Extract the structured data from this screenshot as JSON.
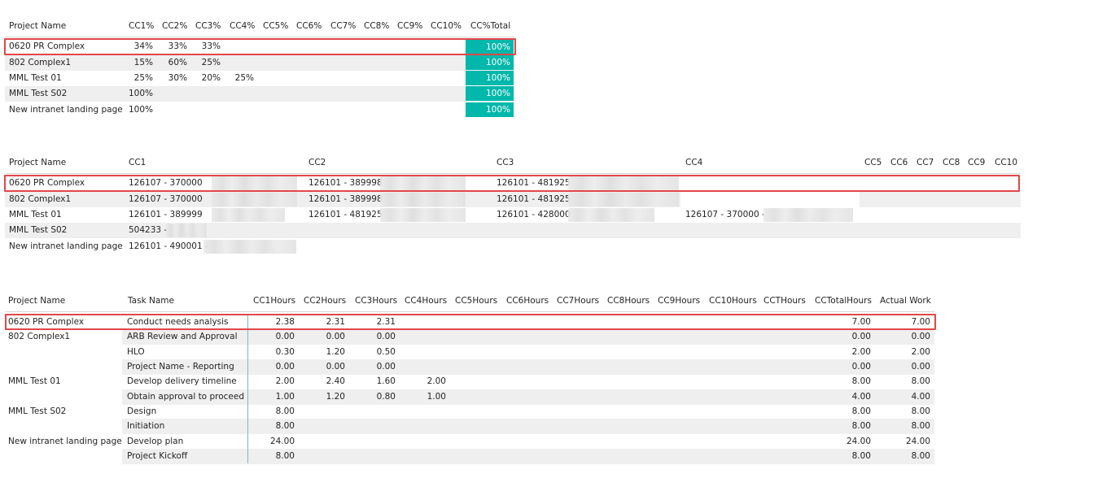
{
  "pct_table": {
    "headers": [
      "Project Name",
      "CC1%",
      "CC2%",
      "CC3%",
      "CC4%",
      "CC5%",
      "CC6%",
      "CC7%",
      "CC8%",
      "CC9%",
      "CC10%",
      "CC%Total"
    ],
    "rows": [
      {
        "name": "0620 PR Complex",
        "cc1": "34%",
        "cc2": "33%",
        "cc3": "33%",
        "cc4": "",
        "total": "100%"
      },
      {
        "name": "802 Complex1",
        "cc1": "15%",
        "cc2": "60%",
        "cc3": "25%",
        "cc4": "",
        "total": "100%"
      },
      {
        "name": "MML Test 01",
        "cc1": "25%",
        "cc2": "30%",
        "cc3": "20%",
        "cc4": "25%",
        "total": "100%"
      },
      {
        "name": "MML Test S02",
        "cc1": "100%",
        "cc2": "",
        "cc3": "",
        "cc4": "",
        "total": "100%"
      },
      {
        "name": "New intranet landing page",
        "cc1": "100%",
        "cc2": "",
        "cc3": "",
        "cc4": "",
        "total": "100%"
      }
    ],
    "total_fill_color": "#01b8aa"
  },
  "code_table": {
    "headers": [
      "Project Name",
      "CC1",
      "CC2",
      "CC3",
      "CC4",
      "CC5",
      "CC6",
      "CC7",
      "CC8",
      "CC9",
      "CC10"
    ],
    "rows": [
      {
        "name": "0620 PR Complex",
        "cc1": "126107 - 370000",
        "cc2": "126101 - 389998",
        "cc3": "126101 - 481925",
        "cc4": ""
      },
      {
        "name": "802 Complex1",
        "cc1": "126107 - 370000",
        "cc2": "126101 - 389998",
        "cc3": "126101 - 481925",
        "cc4": ""
      },
      {
        "name": "MML Test 01",
        "cc1": "126101 - 389999",
        "cc2": "126101 - 481925",
        "cc3": "126101 - 428000",
        "cc4": "126107 - 370000 -"
      },
      {
        "name": "MML Test S02",
        "cc1": "504233 -",
        "cc2": "",
        "cc3": "",
        "cc4": ""
      },
      {
        "name": "New intranet landing page",
        "cc1": "126101 - 490001 -",
        "cc2": "",
        "cc3": "",
        "cc4": ""
      }
    ]
  },
  "hours_table": {
    "headers": [
      "Project Name",
      "Task Name",
      "CC1Hours",
      "CC2Hours",
      "CC3Hours",
      "CC4Hours",
      "CC5Hours",
      "CC6Hours",
      "CC7Hours",
      "CC8Hours",
      "CC9Hours",
      "CC10Hours",
      "CCTHours",
      "CCTotalHours",
      "Actual Work"
    ],
    "rows": [
      {
        "project": "0620 PR Complex",
        "task": "Conduct needs analysis",
        "h1": "2.38",
        "h2": "2.31",
        "h3": "2.31",
        "h4": "",
        "total": "7.00",
        "actual": "7.00"
      },
      {
        "project": "802 Complex1",
        "task": "ARB Review and Approval",
        "h1": "0.00",
        "h2": "0.00",
        "h3": "0.00",
        "h4": "",
        "total": "0.00",
        "actual": "0.00"
      },
      {
        "project": "",
        "task": "HLO",
        "h1": "0.30",
        "h2": "1.20",
        "h3": "0.50",
        "h4": "",
        "total": "2.00",
        "actual": "2.00"
      },
      {
        "project": "",
        "task": "Project Name - Reporting",
        "h1": "0.00",
        "h2": "0.00",
        "h3": "0.00",
        "h4": "",
        "total": "0.00",
        "actual": "0.00"
      },
      {
        "project": "MML Test 01",
        "task": "Develop delivery timeline",
        "h1": "2.00",
        "h2": "2.40",
        "h3": "1.60",
        "h4": "2.00",
        "total": "8.00",
        "actual": "8.00"
      },
      {
        "project": "",
        "task": "Obtain approval to proceed",
        "h1": "1.00",
        "h2": "1.20",
        "h3": "0.80",
        "h4": "1.00",
        "total": "4.00",
        "actual": "4.00"
      },
      {
        "project": "MML Test S02",
        "task": "Design",
        "h1": "8.00",
        "h2": "",
        "h3": "",
        "h4": "",
        "total": "8.00",
        "actual": "8.00"
      },
      {
        "project": "",
        "task": "Initiation",
        "h1": "8.00",
        "h2": "",
        "h3": "",
        "h4": "",
        "total": "8.00",
        "actual": "8.00"
      },
      {
        "project": "New intranet landing page",
        "task": "Develop plan",
        "h1": "24.00",
        "h2": "",
        "h3": "",
        "h4": "",
        "total": "24.00",
        "actual": "24.00"
      },
      {
        "project": "",
        "task": "Project Kickoff",
        "h1": "8.00",
        "h2": "",
        "h3": "",
        "h4": "",
        "total": "8.00",
        "actual": "8.00"
      }
    ]
  },
  "highlight_color": "#e3474a"
}
